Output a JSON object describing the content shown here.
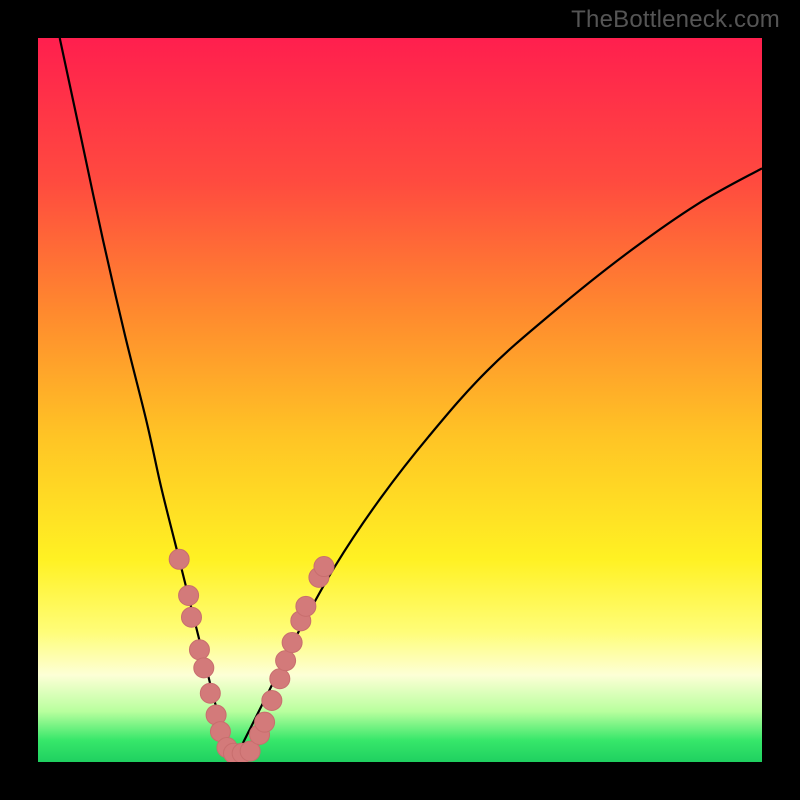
{
  "watermark": "TheBottleneck.com",
  "colors": {
    "frame": "#000000",
    "gradient_stops": [
      {
        "offset": 0.0,
        "color": "#ff1f4e"
      },
      {
        "offset": 0.2,
        "color": "#ff4b3f"
      },
      {
        "offset": 0.38,
        "color": "#ff8a2e"
      },
      {
        "offset": 0.55,
        "color": "#ffc425"
      },
      {
        "offset": 0.72,
        "color": "#fff123"
      },
      {
        "offset": 0.82,
        "color": "#fffd78"
      },
      {
        "offset": 0.88,
        "color": "#fdffd6"
      },
      {
        "offset": 0.93,
        "color": "#b9ff9e"
      },
      {
        "offset": 0.97,
        "color": "#37e76a"
      },
      {
        "offset": 1.0,
        "color": "#1fd060"
      }
    ],
    "curve": "#000000",
    "marker_fill": "#d37a7a",
    "marker_stroke": "#c86e6e"
  },
  "chart_data": {
    "type": "line",
    "title": "",
    "xlabel": "",
    "ylabel": "",
    "xlim": [
      0,
      100
    ],
    "ylim": [
      0,
      100
    ],
    "x_minimum": 27,
    "series": [
      {
        "name": "left-branch",
        "x": [
          3,
          6,
          9,
          12,
          15,
          17,
          19,
          21,
          23,
          24.5,
          26,
          27
        ],
        "y": [
          100,
          86,
          72,
          59,
          47,
          38,
          30,
          22,
          14,
          8,
          3,
          0
        ]
      },
      {
        "name": "right-branch",
        "x": [
          27,
          29,
          32,
          36,
          41,
          47,
          54,
          62,
          71,
          81,
          91,
          100
        ],
        "y": [
          0,
          4,
          10,
          18,
          27,
          36,
          45,
          54,
          62,
          70,
          77,
          82
        ]
      }
    ],
    "markers": {
      "name": "highlighted-points",
      "points": [
        {
          "x": 19.5,
          "y": 28
        },
        {
          "x": 20.8,
          "y": 23
        },
        {
          "x": 21.2,
          "y": 20
        },
        {
          "x": 22.3,
          "y": 15.5
        },
        {
          "x": 22.9,
          "y": 13
        },
        {
          "x": 23.8,
          "y": 9.5
        },
        {
          "x": 24.6,
          "y": 6.5
        },
        {
          "x": 25.2,
          "y": 4.2
        },
        {
          "x": 26.1,
          "y": 2.0
        },
        {
          "x": 27.0,
          "y": 1.2
        },
        {
          "x": 28.2,
          "y": 1.2
        },
        {
          "x": 29.3,
          "y": 1.5
        },
        {
          "x": 30.6,
          "y": 3.8
        },
        {
          "x": 31.3,
          "y": 5.5
        },
        {
          "x": 32.3,
          "y": 8.5
        },
        {
          "x": 33.4,
          "y": 11.5
        },
        {
          "x": 34.2,
          "y": 14.0
        },
        {
          "x": 35.1,
          "y": 16.5
        },
        {
          "x": 36.3,
          "y": 19.5
        },
        {
          "x": 37.0,
          "y": 21.5
        },
        {
          "x": 38.8,
          "y": 25.5
        },
        {
          "x": 39.5,
          "y": 27.0
        }
      ]
    }
  }
}
